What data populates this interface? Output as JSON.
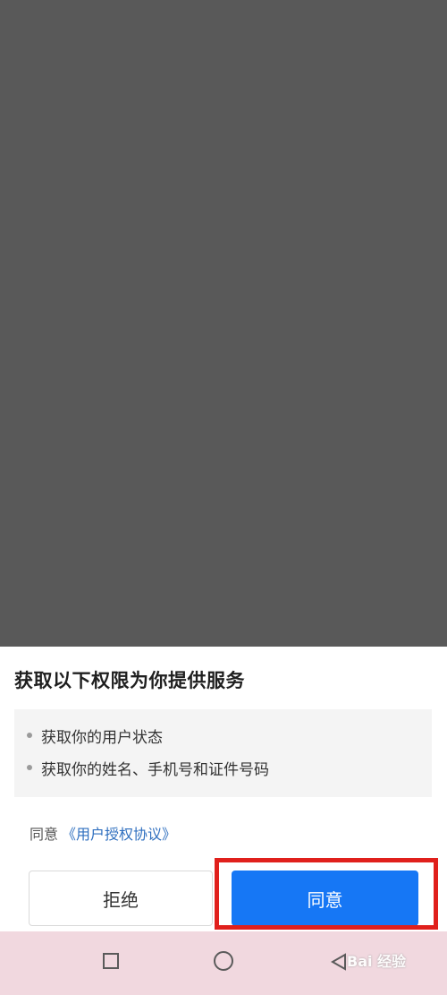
{
  "dialog": {
    "title": "获取以下权限为你提供服务",
    "permissions": [
      "获取你的用户状态",
      "获取你的姓名、手机号和证件号码"
    ],
    "agree_prefix": "同意",
    "agreement_link": "《用户授权协议》",
    "reject_label": "拒绝",
    "agree_label": "同意"
  },
  "annotation": {
    "highlight_color": "#e0201c"
  },
  "nav_bar": {
    "icons": [
      "recent-apps-icon",
      "home-icon",
      "back-icon"
    ]
  },
  "watermark": {
    "text": "Bai 经验"
  },
  "colors": {
    "primary_button": "#1677f5",
    "link": "#2f6fbf",
    "overlay": "#595959"
  }
}
